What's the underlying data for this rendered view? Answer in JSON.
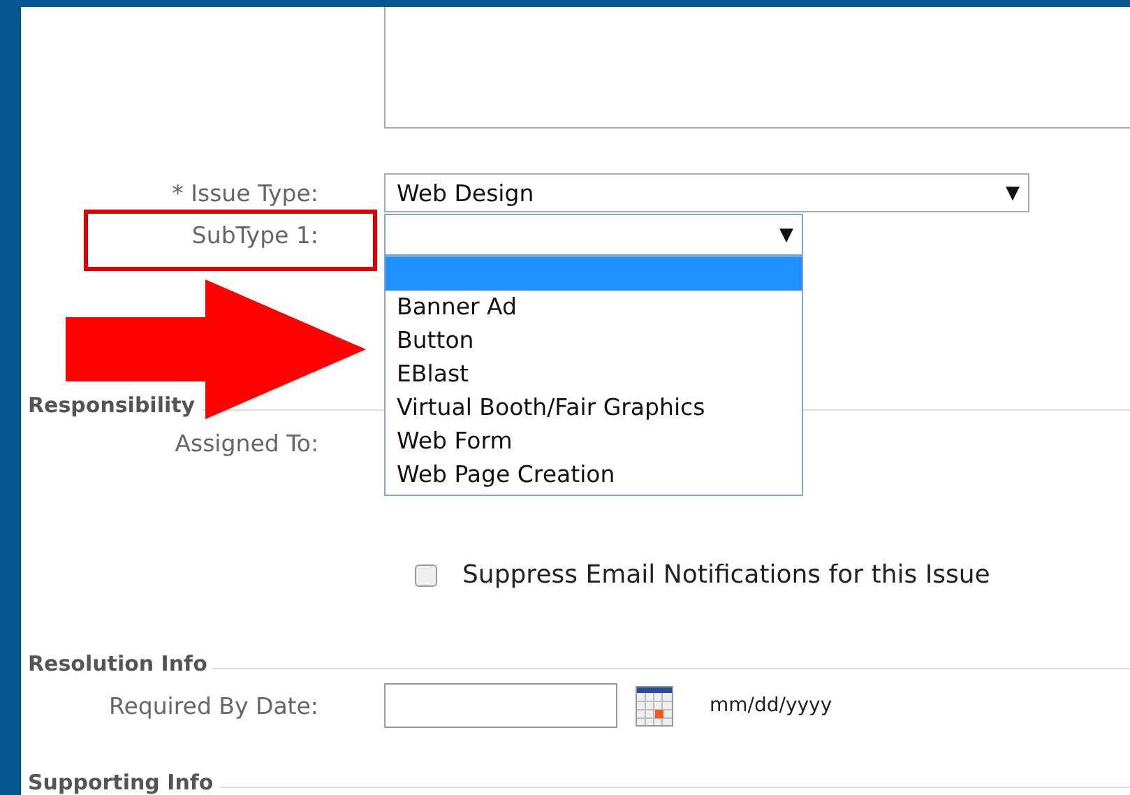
{
  "issue_type": {
    "label": "* Issue Type:",
    "value": "Web Design",
    "arrow": "▼"
  },
  "subtype": {
    "label": "SubType 1:",
    "arrow": "▼",
    "highlighted": true,
    "options": [
      {
        "selected": true
      },
      {
        "label": "Banner Ad",
        "selected": false
      },
      {
        "label": "Button",
        "selected": false
      },
      {
        "label": "EBlast",
        "selected": false
      },
      {
        "label": "Virtual Booth/Fair Graphics",
        "selected": false
      },
      {
        "label": "Web Form",
        "selected": false
      },
      {
        "label": "Web Page Creation",
        "selected": false
      }
    ]
  },
  "responsibility": {
    "heading": "Responsibility",
    "assigned_label": "Assigned To:"
  },
  "suppress": {
    "label": "Suppress Email Notifications for this Issue",
    "checked": false
  },
  "resolution": {
    "heading": "Resolution Info",
    "date_label": "Required By Date:",
    "date_hint": "mm/dd/yyyy"
  },
  "supporting": {
    "heading": "Supporting Info"
  }
}
